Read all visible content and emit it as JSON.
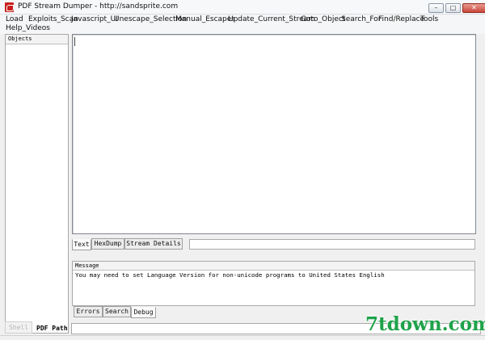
{
  "window": {
    "title": "PDF Stream Dumper - http://sandsprite.com"
  },
  "menu": {
    "items": [
      {
        "label": "Load"
      },
      {
        "label": "Exploits_Scan"
      },
      {
        "label": "Javascript_UI"
      },
      {
        "label": "Unescape_Selection"
      },
      {
        "label": "Manual_Escapes"
      },
      {
        "label": "Update_Current_Stream"
      },
      {
        "label": "Goto_Object"
      },
      {
        "label": "Search_For"
      },
      {
        "label": "Find/Replace"
      },
      {
        "label": "Tools"
      },
      {
        "label": "Help_Videos"
      }
    ]
  },
  "objects_panel": {
    "header": "Objects"
  },
  "editor": {
    "content": ""
  },
  "view_tabs": [
    {
      "label": "Text",
      "active": true
    },
    {
      "label": "HexDump",
      "active": false
    },
    {
      "label": "Stream Details",
      "active": false
    }
  ],
  "messages": {
    "header": "Message",
    "rows": [
      "You may need to set Language Version for non-unicode programs to United States English"
    ]
  },
  "log_tabs": [
    {
      "label": "Errors",
      "active": false
    },
    {
      "label": "Search",
      "active": false
    },
    {
      "label": "Debug",
      "active": true
    }
  ],
  "bottom": {
    "shell_label": "Shell",
    "pdf_path_label": "PDF Path",
    "pdf_path_value": ""
  },
  "watermark": "7tdown.com",
  "colors": {
    "accent_pdf_icon": "#c8201e",
    "watermark": "#1fa24a"
  }
}
